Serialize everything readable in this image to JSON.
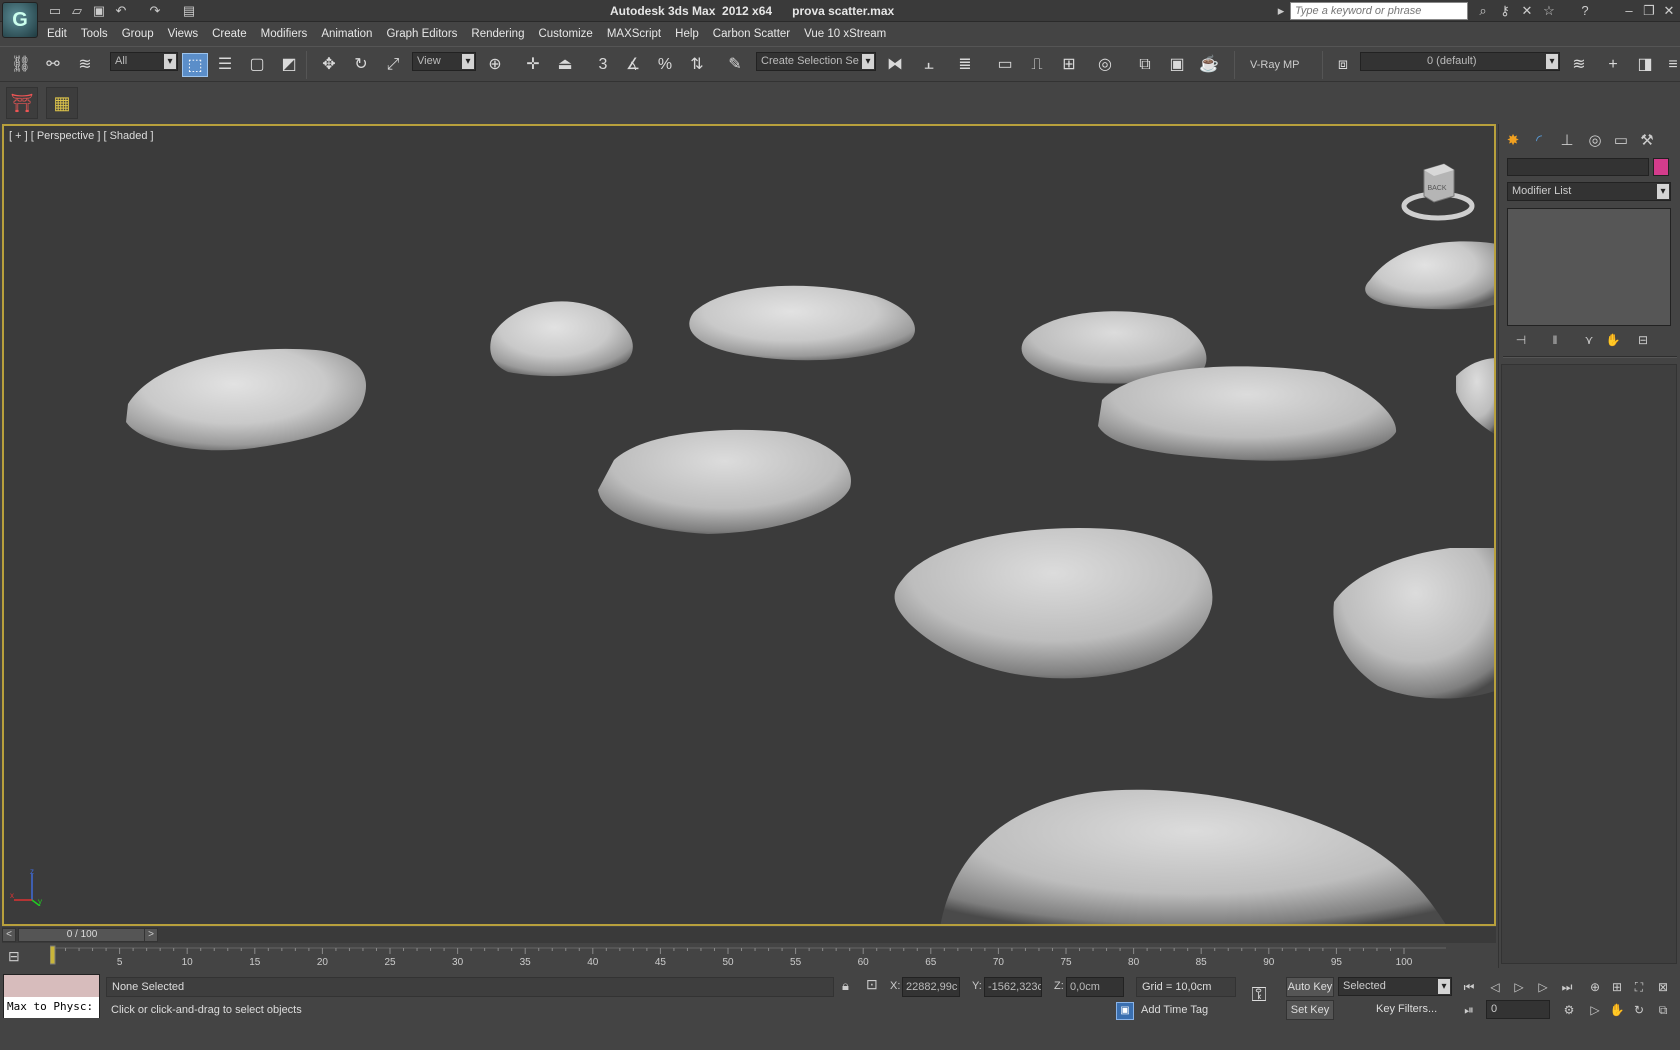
{
  "titlebar": {
    "app_title": "Autodesk 3ds Max  2012 x64",
    "file_name": "prova scatter.max",
    "search_placeholder": "Type a keyword or phrase",
    "logo_text": "G"
  },
  "menubar": [
    "Edit",
    "Tools",
    "Group",
    "Views",
    "Create",
    "Modifiers",
    "Animation",
    "Graph Editors",
    "Rendering",
    "Customize",
    "MAXScript",
    "Help",
    "Carbon Scatter",
    "Vue 10 xStream"
  ],
  "toolbar": {
    "selection_filter": "All",
    "ref_coord": "View",
    "named_selection": "Create Selection Se",
    "renderer_label": "V-Ray MP",
    "layer": "0 (default)",
    "snap_label": "3"
  },
  "viewport": {
    "label": "[ + ] [ Perspective ] [ Shaded ]",
    "viewcube_face": "BACK",
    "axis": {
      "x": "x",
      "y": "y",
      "z": "z"
    }
  },
  "command_panel": {
    "modifier_list": "Modifier List",
    "object_color": "#d43c8c"
  },
  "timeslider": {
    "position": "0 / 100",
    "prev": "<",
    "next": ">"
  },
  "trackbar": {
    "frame_start": 0,
    "frame_end": 100,
    "labels": [
      "5",
      "10",
      "15",
      "20",
      "25",
      "30",
      "35",
      "40",
      "45",
      "50",
      "55",
      "60",
      "65",
      "70",
      "75",
      "80",
      "85",
      "90",
      "95",
      "100"
    ]
  },
  "status": {
    "listener": "Max to Physc:",
    "selection": "None Selected",
    "prompt": "Click or click-and-drag to select objects",
    "x_label": "X:",
    "x_value": "22882,99c",
    "y_label": "Y:",
    "y_value": "-1562,323c",
    "z_label": "Z:",
    "z_value": "0,0cm",
    "grid": "Grid = 10,0cm",
    "add_time_tag": "Add Time Tag",
    "auto_key": "Auto Key",
    "set_key": "Set Key",
    "key_mode": "Selected",
    "key_filters": "Key Filters...",
    "current_frame": "0"
  },
  "colors": {
    "viewport_bg": "#3b3b3b",
    "viewport_border": "#b8a03c",
    "active_tool": "#5b8ec9",
    "rock_light": "#d9d9d9",
    "rock_dark": "#6a6a6a"
  }
}
